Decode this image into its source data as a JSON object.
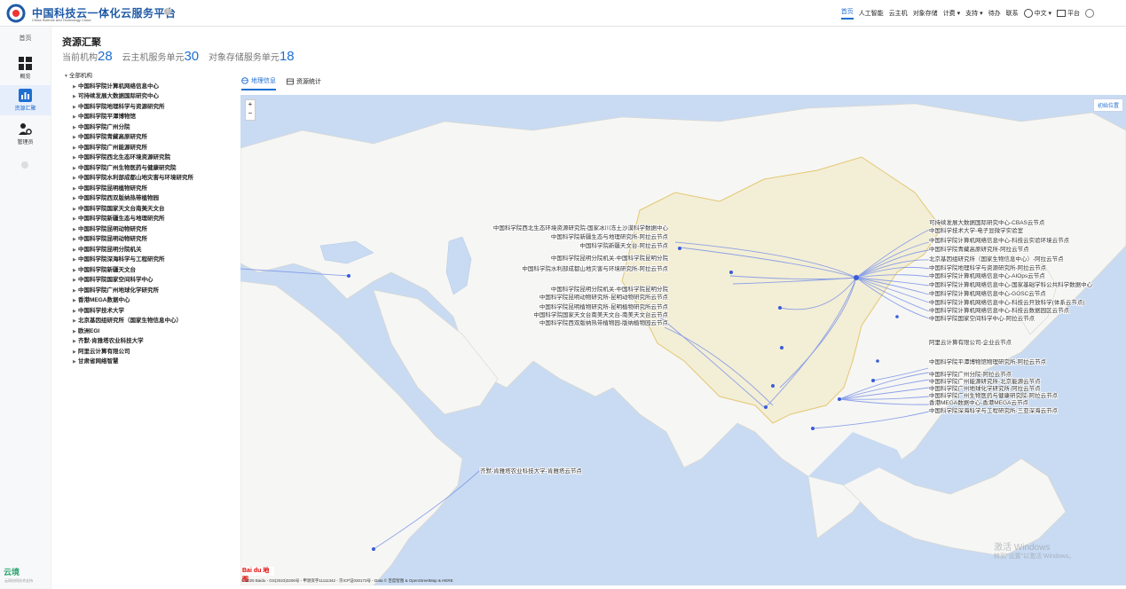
{
  "app": {
    "brand": "中国科技云一体化云服务平台",
    "brand_sub": "China Science and Technology Cloud"
  },
  "topnav": {
    "items": [
      "首页",
      "人工智能",
      "云主机",
      "对象存储",
      "计费",
      "支持",
      "待办",
      "联系",
      "中文",
      "平台"
    ],
    "active_index": 0
  },
  "sidebar": {
    "home": "首页",
    "items": [
      {
        "label": "概览",
        "icon": "grid-icon"
      },
      {
        "label": "资源汇聚",
        "icon": "bar-chart-icon"
      },
      {
        "label": "管理员",
        "icon": "admin-gear-icon"
      }
    ],
    "active_index": 1,
    "footer_logo": "云境",
    "footer_sub": "云网协同技术支持"
  },
  "page": {
    "title": "资源汇聚",
    "stats": [
      {
        "label": "当前机构",
        "value": "28"
      },
      {
        "label": "云主机服务单元",
        "value": "30"
      },
      {
        "label": "对象存储服务单元",
        "value": "18"
      }
    ]
  },
  "tree": {
    "root": "全部机构",
    "items": [
      "中国科学院计算机网络信息中心",
      "可持续发展大数据国际研究中心",
      "中国科学院地理科学与资源研究所",
      "中国科学院平潭博物馆",
      "中国科学院广州分院",
      "中国科学院青藏高原研究所",
      "中国科学院广州能源研究所",
      "中国科学院西北生态环境资源研究院",
      "中国科学院广州生物医药与健康研究院",
      "中国科学院水利部成都山地灾害与环境研究所",
      "中国科学院昆明植物研究所",
      "中国科学院西双版纳热带植物园",
      "中国科学院国家天文台南美天文台",
      "中国科学院新疆生态与地理研究所",
      "中国科学院昆明动物研究所",
      "中国科学院昆明动物研究所",
      "中国科学院昆明分院机关",
      "中国科学院深海科学与工程研究所",
      "中国科学院新疆天文台",
      "中国科学院国家空间科学中心",
      "中国科学院广州地球化学研究所",
      "香港MEGA数据中心",
      "中国科学技术大学",
      "北京基因组研究所（国家生物信息中心）",
      "欧洲EGI",
      "齐默-肯雅塔农业科技大学",
      "阿里云计算有限公司",
      "甘肃省网络智慧"
    ]
  },
  "tabs": [
    {
      "label": "地理信息",
      "icon": "globe-icon"
    },
    {
      "label": "资源统计",
      "icon": "table-icon"
    }
  ],
  "tabs_active": 0,
  "map": {
    "reset_label": "初始位置",
    "copyright": "© 2025 Baidu - GS(2023)3206号 - 甲测资字11111342 - 京ICP证030173号 - Data © 百度智图 & OpenStreetMap & HERE",
    "baidu_logo": "Bai du 地图",
    "watermark": "激活 Windows",
    "watermark_sub": "转到\"设置\"以激活 Windows。",
    "labels_left": [
      "中国科学院西北生态环境资源研究院-国家冰川冻土沙漠科学数据中心",
      "中国科学院新疆生态与地理研究所-阿拉云节点",
      "中国科学院新疆天文台-阿拉云节点",
      "中国科学院昆明分院机关-中国科学院昆明分院",
      "中国科学院水利部成都山地灾害与环境研究所-阿拉云节点",
      "中国科学院昆明分院机关-中国科学院昆明分院",
      "中国科学院昆明动物研究所-昆明动物研究所云节点",
      "中国科学院昆明植物研究所-昆明植物研究所云节点",
      "中国科学院国家天文台南美天文台-南美天文台云节点",
      "中国科学院西双版纳热带植物园-版纳植物园云节点"
    ],
    "labels_right": [
      "可持续发展大数据国际研究中心-CBAS云节点",
      "中国科学技术大学-电子显微学实验室",
      "中国科学院计算机网络信息中心-科技云实验环境云节点",
      "中国科学院青藏高原研究所-阿拉云节点",
      "北京基因组研究所（国家生物信息中心）-阿拉云节点",
      "中国科学院地理科学与资源研究所-阿拉云节点",
      "中国科学院计算机网络信息中心-AIOps云节点",
      "中国科学院计算机网络信息中心-国家基础学科公共科学数据中心",
      "中国科学院计算机网络信息中心-GOSC云节点",
      "中国科学院计算机网络信息中心-科技云开放科学(体系云节点)",
      "中国科学院计算机网络信息中心-科技云数据园区云节点",
      "中国科学院国家空间科学中心-阿拉云节点",
      "阿里云计算有限公司-企业云节点",
      "中国科学院平潭博物馆物理研究所-阿拉云节点",
      "中国科学院广州分院-阿拉云节点",
      "中国科学院广州能源研究所-北京能源云节点",
      "中国科学院广州地球化学研究所-阿拉云节点",
      "中国科学院广州生物医药与健康研究院-阿拉云节点",
      "香港MEGA数据中心-香港MEGA云节点",
      "中国科学院深海科学与工程研究所-三亚深海云节点"
    ],
    "label_africa": "齐默-肯雅塔农业科技大学-肯雅塔云节点",
    "label_europe": "欧洲EGI"
  },
  "colors": {
    "accent": "#1f6fd1",
    "sea": "#c9dbf2",
    "land": "#f6f6f4",
    "china": "#f3eed6",
    "arc": "#7a94e8",
    "node": "#3a5bd9"
  }
}
